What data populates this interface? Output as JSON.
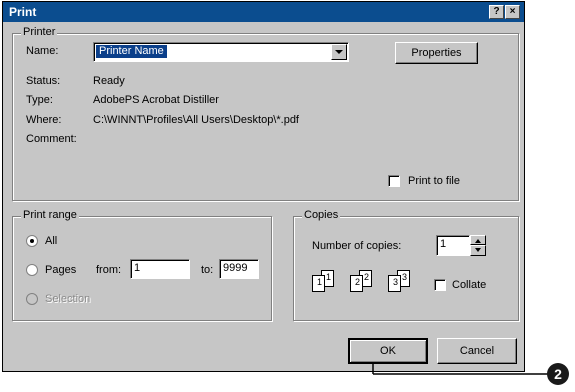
{
  "window": {
    "title": "Print",
    "help_button": "?",
    "close_button": "×"
  },
  "printer": {
    "group_label": "Printer",
    "name_label": "Name:",
    "name_value": "Printer Name",
    "properties_button": "Properties",
    "status_label": "Status:",
    "status_value": "Ready",
    "type_label": "Type:",
    "type_value": "AdobePS Acrobat Distiller",
    "where_label": "Where:",
    "where_value": "C:\\WINNT\\Profiles\\All Users\\Desktop\\*.pdf",
    "comment_label": "Comment:",
    "print_to_file_label": "Print to file"
  },
  "print_range": {
    "group_label": "Print range",
    "all_label": "All",
    "pages_label": "Pages",
    "from_label": "from:",
    "from_value": "1",
    "to_label": "to:",
    "to_value": "9999",
    "selection_label": "Selection",
    "selected": "all"
  },
  "copies": {
    "group_label": "Copies",
    "number_label": "Number of copies:",
    "number_value": "1",
    "collate_label": "Collate",
    "collate_pages": [
      "1",
      "1",
      "2",
      "2",
      "3",
      "3"
    ]
  },
  "buttons": {
    "ok": "OK",
    "cancel": "Cancel"
  },
  "callout": {
    "number": "2"
  },
  "colors": {
    "titlebar": "#0b4d8f",
    "dialog_bg": "#c6c6c6",
    "selection": "#0b3f8a"
  }
}
